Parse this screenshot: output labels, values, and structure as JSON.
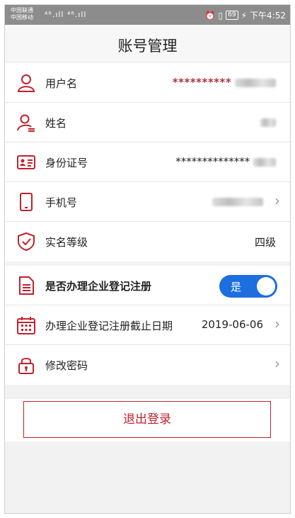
{
  "statusbar": {
    "carrier1": "中国联通",
    "carrier2": "中国移动",
    "signal": "⁴⁶.ıll ⁴⁶.ıll",
    "alarm_icon": "alarm-icon",
    "battery": "69",
    "time": "下午4:52"
  },
  "header": {
    "title": "账号管理"
  },
  "account": [
    {
      "icon": "user-icon",
      "label": "用户名",
      "value": "**********"
    },
    {
      "icon": "person-edit-icon",
      "label": "姓名",
      "value": ""
    },
    {
      "icon": "id-card-icon",
      "label": "身份证号",
      "value": "**************"
    },
    {
      "icon": "phone-icon",
      "label": "手机号",
      "value": ""
    },
    {
      "icon": "shield-check-icon",
      "label": "实名等级",
      "value": "四级"
    }
  ],
  "settings": {
    "register": {
      "label": "是否办理企业登记注册",
      "toggle_label": "是",
      "on": true
    },
    "deadline": {
      "label": "办理企业登记注册截止日期",
      "value": "2019-06-06"
    },
    "password": {
      "label": "修改密码"
    }
  },
  "logout": {
    "label": "退出登录"
  },
  "colors": {
    "accent_red": "#c0222d",
    "toggle_blue": "#1d6fe0"
  }
}
